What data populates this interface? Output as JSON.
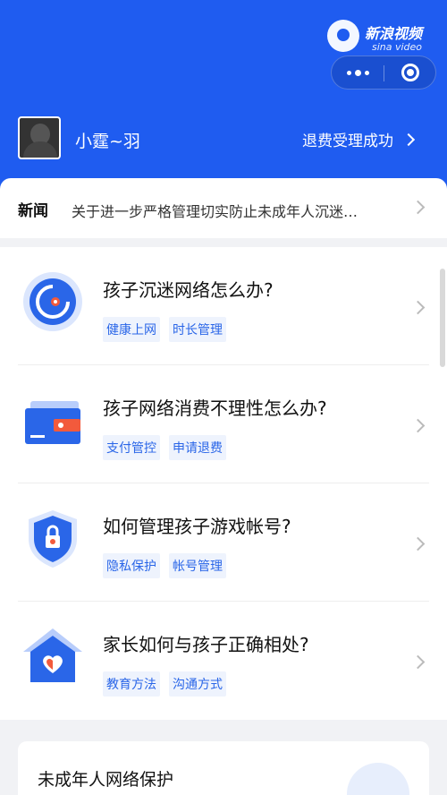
{
  "watermark": {
    "title": "新浪视频",
    "subtitle": "sina video"
  },
  "profile": {
    "username": "小霆~羽",
    "refund_status": "退费受理成功"
  },
  "news": {
    "tag": "新闻",
    "headline": "关于进一步严格管理切实防止未成年人沉迷…"
  },
  "faq": [
    {
      "title": "孩子沉迷网络怎么办?",
      "tags": [
        "健康上网",
        "时长管理"
      ],
      "icon": "clock-target-icon"
    },
    {
      "title": "孩子网络消费不理性怎么办?",
      "tags": [
        "支付管控",
        "申请退费"
      ],
      "icon": "wallet-icon"
    },
    {
      "title": "如何管理孩子游戏帐号?",
      "tags": [
        "隐私保护",
        "帐号管理"
      ],
      "icon": "shield-lock-icon"
    },
    {
      "title": "家长如何与孩子正确相处?",
      "tags": [
        "教育方法",
        "沟通方式"
      ],
      "icon": "house-heart-icon"
    }
  ],
  "bottom_section": {
    "title": "未成年人网络保护"
  },
  "colors": {
    "brand": "#1f5cf0",
    "tag_bg": "#eef3fd",
    "tag_text": "#2a66e8"
  }
}
